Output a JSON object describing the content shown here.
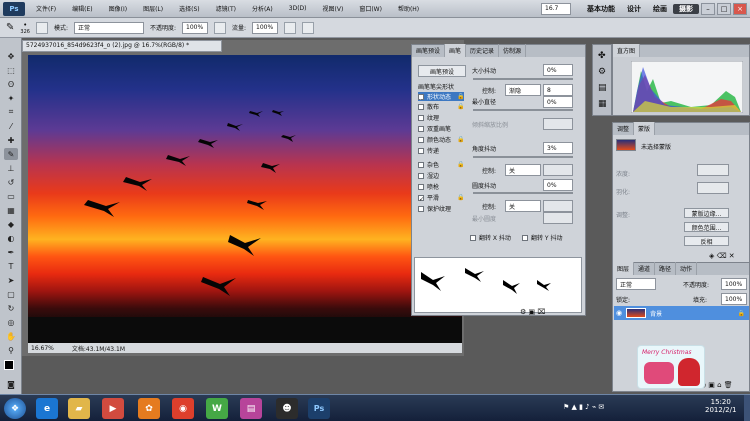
{
  "app": {
    "logo": "Ps",
    "menus": [
      "文件(F)",
      "编辑(E)",
      "图像(I)",
      "图层(L)",
      "选择(S)",
      "滤镜(T)",
      "分析(A)",
      "3D(D)",
      "视图(V)",
      "窗口(W)",
      "帮助(H)"
    ],
    "zoom_display": "16.7",
    "workspaces": [
      "基本功能",
      "设计",
      "绘画",
      "摄影"
    ],
    "active_workspace": "摄影"
  },
  "options_bar": {
    "brush_size": "326",
    "mode_label": "模式:",
    "mode_value": "正常",
    "opacity_label": "不透明度:",
    "opacity_value": "100%",
    "flow_label": "流量:",
    "flow_value": "100%"
  },
  "document": {
    "tab_title": "5724937016_854d9623f4_o (2).jpg @ 16.7%(RGB/8) *",
    "status_zoom": "16.67%",
    "status_doc": "文档:43.1M/43.1M"
  },
  "brush_panel": {
    "tabs": [
      "画笔预设",
      "画笔",
      "历史记录",
      "仿制源"
    ],
    "preset_button": "画笔预设",
    "options": [
      {
        "label": "画笔笔尖形状",
        "checked": false,
        "active": false
      },
      {
        "label": "形状动态",
        "checked": true,
        "active": true
      },
      {
        "label": "散布",
        "checked": false,
        "active": false
      },
      {
        "label": "纹理",
        "checked": false,
        "active": false
      },
      {
        "label": "双重画笔",
        "checked": false,
        "active": false
      },
      {
        "label": "颜色动态",
        "checked": false,
        "active": false
      },
      {
        "label": "传递",
        "checked": false,
        "active": false
      },
      {
        "label": "杂色",
        "checked": false,
        "active": false
      },
      {
        "label": "湿边",
        "checked": false,
        "active": false
      },
      {
        "label": "喷枪",
        "checked": false,
        "active": false
      },
      {
        "label": "平滑",
        "checked": true,
        "active": false
      },
      {
        "label": "保护纹理",
        "checked": false,
        "active": false
      }
    ],
    "size_jitter_label": "大小抖动",
    "size_jitter_value": "0%",
    "control_label": "控制:",
    "control1_value": "渐隐",
    "control1_number": "8",
    "min_diameter_label": "最小直径",
    "min_diameter_value": "0%",
    "tilt_scale_label": "倾斜缩放比例",
    "angle_jitter_label": "角度抖动",
    "angle_jitter_value": "3%",
    "control2_value": "关",
    "roundness_jitter_label": "圆度抖动",
    "roundness_jitter_value": "0%",
    "control3_value": "关",
    "min_roundness_label": "最小圆度",
    "flip_x_label": "翻转 X 抖动",
    "flip_y_label": "翻转 Y 抖动"
  },
  "histogram_panel": {
    "title": "直方图"
  },
  "adjust_panel": {
    "tabs": [
      "调整",
      "蒙版"
    ],
    "mask_title": "未选择蒙版",
    "density_label": "浓度:",
    "feather_label": "羽化:",
    "refine_label": "调整:",
    "mask_edge_button": "蒙版边缘...",
    "color_range_button": "颜色范围...",
    "invert_button": "反相"
  },
  "layers_panel": {
    "tabs": [
      "图层",
      "通道",
      "路径",
      "动作"
    ],
    "blend_mode": "正常",
    "opacity_label": "不透明度:",
    "opacity_value": "100%",
    "lock_label": "锁定:",
    "fill_label": "填充:",
    "fill_value": "100%",
    "layer_name": "背景"
  },
  "sticker": {
    "text": "Merry Christmas"
  },
  "taskbar": {
    "apps": [
      "ie-icon",
      "folder-icon",
      "media-icon",
      "app-icon",
      "chrome-icon",
      "wps-icon",
      "pdf-icon",
      "qq-icon",
      "ps-icon"
    ],
    "time": "15:20",
    "date": "2012/2/1"
  }
}
